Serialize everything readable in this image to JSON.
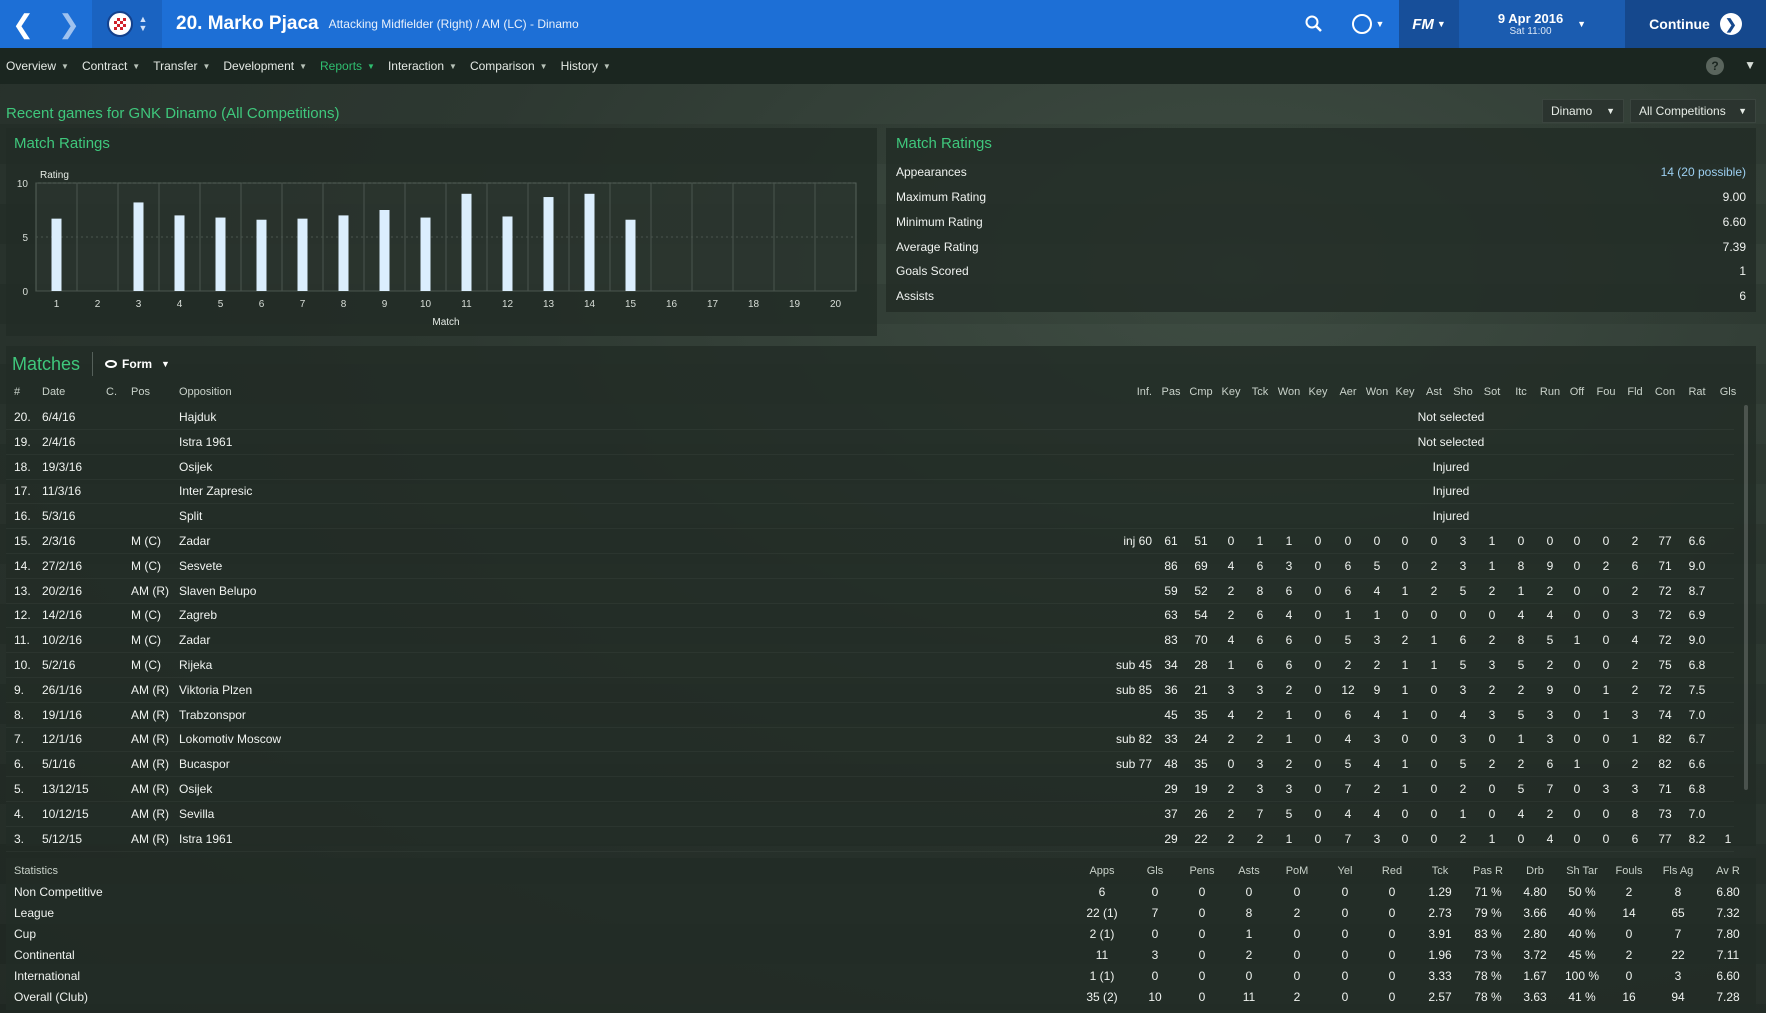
{
  "header": {
    "player_title": "20. Marko Pjaca",
    "player_subtitle": "Attacking Midfielder (Right) / AM (LC) - Dinamo",
    "date_main": "9 Apr 2016",
    "date_sub": "Sat 11:00",
    "continue_label": "Continue",
    "fm_label": "FM",
    "accent_color": "#1d6fd6"
  },
  "menu": {
    "items": [
      {
        "label": "Overview"
      },
      {
        "label": "Contract"
      },
      {
        "label": "Transfer"
      },
      {
        "label": "Development"
      },
      {
        "label": "Reports"
      },
      {
        "label": "Interaction"
      },
      {
        "label": "Comparison"
      },
      {
        "label": "History"
      }
    ],
    "active": "Reports",
    "help_label": "?"
  },
  "page": {
    "title": "Recent games for GNK Dinamo (All Competitions)",
    "club_filter": "Dinamo",
    "competition_filter": "All Competitions"
  },
  "ratings_chart": {
    "panel_title": "Match Ratings",
    "chart_data": {
      "type": "bar",
      "ylabel": "Rating",
      "xlabel": "Match",
      "ylim": [
        0,
        10
      ],
      "yticks": [
        0,
        5,
        10
      ],
      "categories": [
        "1",
        "2",
        "3",
        "4",
        "5",
        "6",
        "7",
        "8",
        "9",
        "10",
        "11",
        "12",
        "13",
        "14",
        "15",
        "16",
        "17",
        "18",
        "19",
        "20"
      ],
      "values": [
        6.7,
        null,
        8.2,
        7.0,
        6.8,
        6.6,
        6.7,
        7.0,
        7.5,
        6.8,
        9.0,
        6.9,
        8.7,
        9.0,
        6.6,
        null,
        null,
        null,
        null,
        null
      ],
      "bar_color": "#dbeefd",
      "grid": true
    }
  },
  "summary": {
    "panel_title": "Match Ratings",
    "rows": [
      {
        "label": "Appearances",
        "value": "14 (20 possible)"
      },
      {
        "label": "Maximum Rating",
        "value": "9.00"
      },
      {
        "label": "Minimum Rating",
        "value": "6.60"
      },
      {
        "label": "Average Rating",
        "value": "7.39"
      },
      {
        "label": "Goals Scored",
        "value": "1"
      },
      {
        "label": "Assists",
        "value": "6"
      }
    ]
  },
  "matches": {
    "title": "Matches",
    "view_label": "Form",
    "columns": [
      "#",
      "Date",
      "C.",
      "Pos",
      "Opposition",
      "Inf.",
      "Pas",
      "Cmp",
      "Key",
      "Tck",
      "Won",
      "Key",
      "Aer",
      "Won",
      "Key",
      "Ast",
      "Sho",
      "Sot",
      "Itc",
      "Run",
      "Off",
      "Fou",
      "Fld",
      "Con",
      "Rat",
      "Gls"
    ],
    "rows": [
      {
        "num": "20.",
        "date": "6/4/16",
        "c": "",
        "pos": "",
        "opp": "Hajduk",
        "note": "Not selected"
      },
      {
        "num": "19.",
        "date": "2/4/16",
        "c": "",
        "pos": "",
        "opp": "Istra 1961",
        "note": "Not selected"
      },
      {
        "num": "18.",
        "date": "19/3/16",
        "c": "",
        "pos": "",
        "opp": "Osijek",
        "note": "Injured"
      },
      {
        "num": "17.",
        "date": "11/3/16",
        "c": "",
        "pos": "",
        "opp": "Inter Zapresic",
        "note": "Injured"
      },
      {
        "num": "16.",
        "date": "5/3/16",
        "c": "",
        "pos": "",
        "opp": "Split",
        "note": "Injured"
      },
      {
        "num": "15.",
        "date": "2/3/16",
        "c": "",
        "pos": "M (C)",
        "opp": "Zadar",
        "inf": "inj 60",
        "stats": [
          "61",
          "51",
          "0",
          "1",
          "1",
          "0",
          "0",
          "0",
          "0",
          "0",
          "3",
          "1",
          "0",
          "0",
          "0",
          "0",
          "2",
          "77",
          "6.6",
          ""
        ]
      },
      {
        "num": "14.",
        "date": "27/2/16",
        "c": "",
        "pos": "M (C)",
        "opp": "Sesvete",
        "inf": "",
        "stats": [
          "86",
          "69",
          "4",
          "6",
          "3",
          "0",
          "6",
          "5",
          "0",
          "2",
          "3",
          "1",
          "8",
          "9",
          "0",
          "2",
          "6",
          "71",
          "9.0",
          ""
        ]
      },
      {
        "num": "13.",
        "date": "20/2/16",
        "c": "",
        "pos": "AM (R)",
        "opp": "Slaven Belupo",
        "inf": "",
        "stats": [
          "59",
          "52",
          "2",
          "8",
          "6",
          "0",
          "6",
          "4",
          "1",
          "2",
          "5",
          "2",
          "1",
          "2",
          "0",
          "0",
          "2",
          "72",
          "8.7",
          ""
        ]
      },
      {
        "num": "12.",
        "date": "14/2/16",
        "c": "",
        "pos": "M (C)",
        "opp": "Zagreb",
        "inf": "",
        "stats": [
          "63",
          "54",
          "2",
          "6",
          "4",
          "0",
          "1",
          "1",
          "0",
          "0",
          "0",
          "0",
          "4",
          "4",
          "0",
          "0",
          "3",
          "72",
          "6.9",
          ""
        ]
      },
      {
        "num": "11.",
        "date": "10/2/16",
        "c": "",
        "pos": "M (C)",
        "opp": "Zadar",
        "inf": "",
        "stats": [
          "83",
          "70",
          "4",
          "6",
          "6",
          "0",
          "5",
          "3",
          "2",
          "1",
          "6",
          "2",
          "8",
          "5",
          "1",
          "0",
          "4",
          "72",
          "9.0",
          ""
        ]
      },
      {
        "num": "10.",
        "date": "5/2/16",
        "c": "",
        "pos": "M (C)",
        "opp": "Rijeka",
        "inf": "sub 45",
        "stats": [
          "34",
          "28",
          "1",
          "6",
          "6",
          "0",
          "2",
          "2",
          "1",
          "1",
          "5",
          "3",
          "5",
          "2",
          "0",
          "0",
          "2",
          "75",
          "6.8",
          ""
        ]
      },
      {
        "num": "9.",
        "date": "26/1/16",
        "c": "",
        "pos": "AM (R)",
        "opp": "Viktoria Plzen",
        "inf": "sub 85",
        "stats": [
          "36",
          "21",
          "3",
          "3",
          "2",
          "0",
          "12",
          "9",
          "1",
          "0",
          "3",
          "2",
          "2",
          "9",
          "0",
          "1",
          "2",
          "72",
          "7.5",
          ""
        ]
      },
      {
        "num": "8.",
        "date": "19/1/16",
        "c": "",
        "pos": "AM (R)",
        "opp": "Trabzonspor",
        "inf": "",
        "stats": [
          "45",
          "35",
          "4",
          "2",
          "1",
          "0",
          "6",
          "4",
          "1",
          "0",
          "4",
          "3",
          "5",
          "3",
          "0",
          "1",
          "3",
          "74",
          "7.0",
          ""
        ]
      },
      {
        "num": "7.",
        "date": "12/1/16",
        "c": "",
        "pos": "AM (R)",
        "opp": "Lokomotiv Moscow",
        "inf": "sub 82",
        "stats": [
          "33",
          "24",
          "2",
          "2",
          "1",
          "0",
          "4",
          "3",
          "0",
          "0",
          "3",
          "0",
          "1",
          "3",
          "0",
          "0",
          "1",
          "82",
          "6.7",
          ""
        ]
      },
      {
        "num": "6.",
        "date": "5/1/16",
        "c": "",
        "pos": "AM (R)",
        "opp": "Bucaspor",
        "inf": "sub 77",
        "stats": [
          "48",
          "35",
          "0",
          "3",
          "2",
          "0",
          "5",
          "4",
          "1",
          "0",
          "5",
          "2",
          "2",
          "6",
          "1",
          "0",
          "2",
          "82",
          "6.6",
          ""
        ]
      },
      {
        "num": "5.",
        "date": "13/12/15",
        "c": "",
        "pos": "AM (R)",
        "opp": "Osijek",
        "inf": "",
        "stats": [
          "29",
          "19",
          "2",
          "3",
          "3",
          "0",
          "7",
          "2",
          "1",
          "0",
          "2",
          "0",
          "5",
          "7",
          "0",
          "3",
          "3",
          "71",
          "6.8",
          ""
        ]
      },
      {
        "num": "4.",
        "date": "10/12/15",
        "c": "",
        "pos": "AM (R)",
        "opp": "Sevilla",
        "inf": "",
        "stats": [
          "37",
          "26",
          "2",
          "7",
          "5",
          "0",
          "4",
          "4",
          "0",
          "0",
          "1",
          "0",
          "4",
          "2",
          "0",
          "0",
          "8",
          "73",
          "7.0",
          ""
        ]
      },
      {
        "num": "3.",
        "date": "5/12/15",
        "c": "",
        "pos": "AM (R)",
        "opp": "Istra 1961",
        "inf": "",
        "stats": [
          "29",
          "22",
          "2",
          "2",
          "1",
          "0",
          "7",
          "3",
          "0",
          "0",
          "2",
          "1",
          "0",
          "4",
          "0",
          "0",
          "6",
          "77",
          "8.2",
          "1"
        ]
      }
    ]
  },
  "statistics": {
    "columns": [
      "Statistics",
      "Apps",
      "Gls",
      "Pens",
      "Asts",
      "PoM",
      "Yel",
      "Red",
      "Tck",
      "Pas R",
      "Drb",
      "Sh Tar",
      "Fouls",
      "Fls Ag",
      "Av R"
    ],
    "rows": [
      {
        "label": "Non Competitive",
        "vals": [
          "6",
          "0",
          "0",
          "0",
          "0",
          "0",
          "0",
          "1.29",
          "71 %",
          "4.80",
          "50 %",
          "2",
          "8",
          "6.80"
        ]
      },
      {
        "label": "League",
        "vals": [
          "22 (1)",
          "7",
          "0",
          "8",
          "2",
          "0",
          "0",
          "2.73",
          "79 %",
          "3.66",
          "40 %",
          "14",
          "65",
          "7.32"
        ]
      },
      {
        "label": "Cup",
        "vals": [
          "2 (1)",
          "0",
          "0",
          "1",
          "0",
          "0",
          "0",
          "3.91",
          "83 %",
          "2.80",
          "40 %",
          "0",
          "7",
          "7.80"
        ]
      },
      {
        "label": "Continental",
        "vals": [
          "11",
          "3",
          "0",
          "2",
          "0",
          "0",
          "0",
          "1.96",
          "73 %",
          "3.72",
          "45 %",
          "2",
          "22",
          "7.11"
        ]
      },
      {
        "label": "International",
        "vals": [
          "1 (1)",
          "0",
          "0",
          "0",
          "0",
          "0",
          "0",
          "3.33",
          "78 %",
          "1.67",
          "100 %",
          "0",
          "3",
          "6.60"
        ]
      },
      {
        "label": "Overall (Club)",
        "vals": [
          "35 (2)",
          "10",
          "0",
          "11",
          "2",
          "0",
          "0",
          "2.57",
          "78 %",
          "3.63",
          "41 %",
          "16",
          "94",
          "7.28"
        ]
      }
    ]
  }
}
